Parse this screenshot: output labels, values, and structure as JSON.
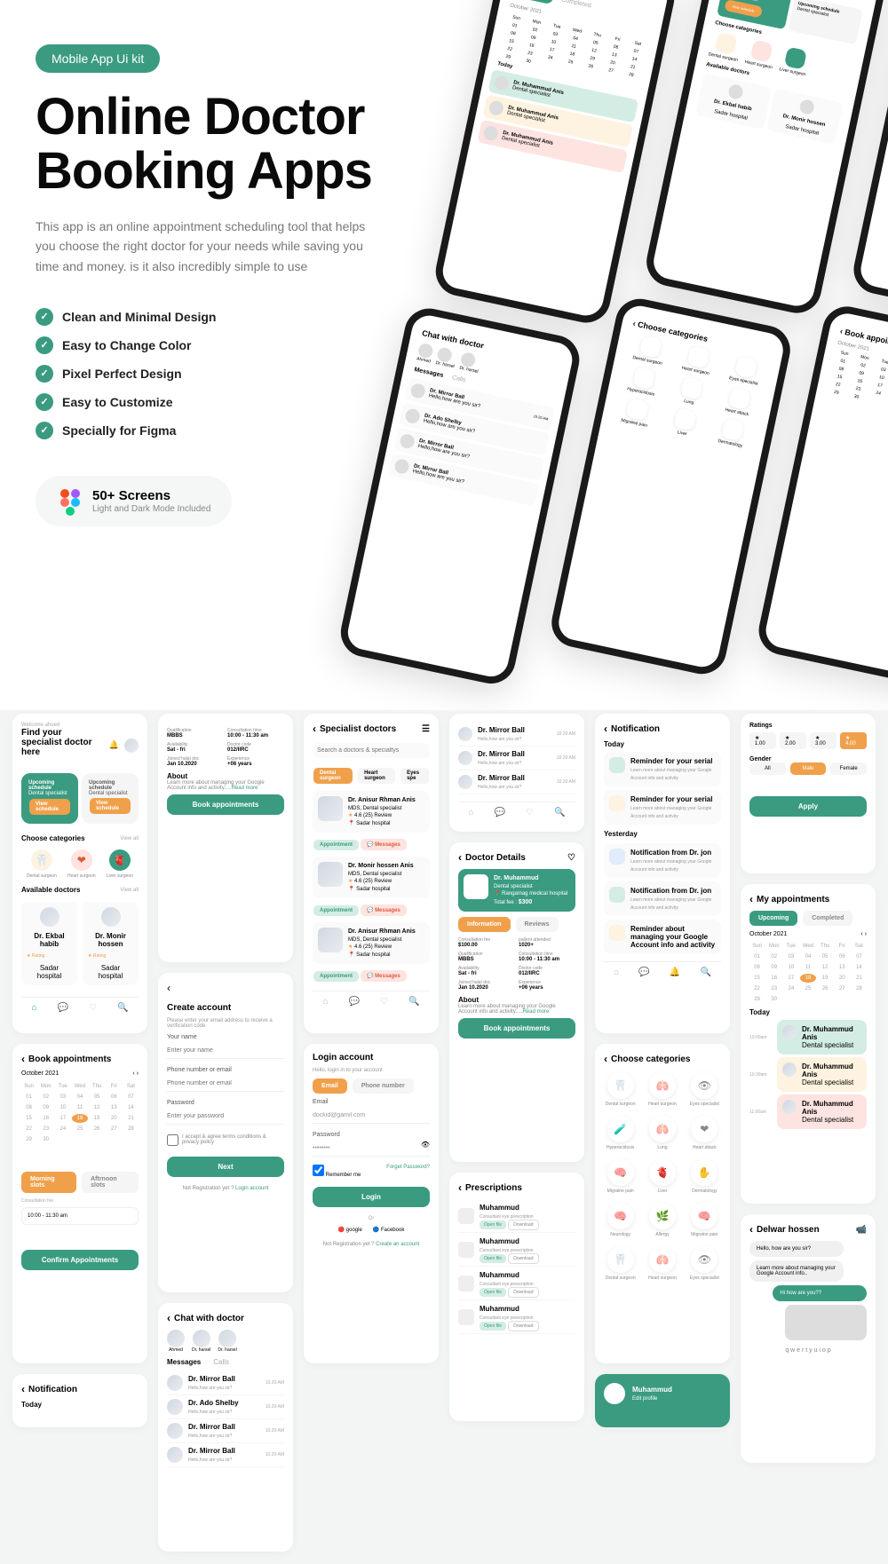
{
  "hero": {
    "badge": "Mobile App Ui kit",
    "title": "Online Doctor Booking Apps",
    "description": "This app is an online appointment scheduling tool that helps you choose the right doctor for your needs while saving you time and money. is it also incredibly simple to use",
    "features": [
      "Clean and Minimal Design",
      "Easy to Change Color",
      "Pixel Perfect Design",
      "Easy to Customize",
      "Specially for Figma"
    ],
    "screens_count": "50+ Screens",
    "screens_sub": "Light and Dark Mode Included"
  },
  "mockups": {
    "appointments": {
      "title": "My appointments",
      "tabs": [
        "Upcoming",
        "Completed"
      ],
      "month": "October 2021",
      "today_label": "Today",
      "doc_name": "Dr. Muhammud Anis",
      "doc_role": "Dental specialist"
    },
    "home": {
      "welcome": "Welcome ahoed",
      "headline": "Find your specialist doctor here",
      "upcoming_title": "Upcoming schedule",
      "upcoming_role": "Dental specialist",
      "view_btn": "View schedule",
      "cat_title": "Choose categories",
      "cats": [
        "Dental surgeon",
        "Heart surgeon",
        "Liver surgeon"
      ],
      "avail_title": "Available doctors",
      "doctors": [
        {
          "name": "Dr. Ekbal habib",
          "rating": "Rating",
          "hospital": "Sadar hospital"
        },
        {
          "name": "Dr. Monir hossen",
          "rating": "Rating",
          "hospital": "Sadar hospital"
        }
      ]
    },
    "chat": {
      "title": "Chat with doctor",
      "contacts": [
        "Ahmed",
        "Dr. harsel",
        "Dr. harsel"
      ],
      "tabs": [
        "Messages",
        "Calls"
      ],
      "msgs": [
        {
          "name": "Dr. Mirror Ball",
          "text": "Hello,how are you sir?",
          "time": "10.20 AM"
        },
        {
          "name": "Dr. Ado Shelby",
          "text": "Hello,how are you sir?",
          "time": "10.20 AM"
        },
        {
          "name": "Dr. Mirror Ball",
          "text": "Hello,how are you sir?",
          "time": "10.20 AM"
        },
        {
          "name": "Dr. Mirror Ball",
          "text": "Hello,how are you sir?",
          "time": "10.20 AM"
        }
      ]
    },
    "categories": {
      "title": "Choose categories",
      "items": [
        "Dental surgeon",
        "Heart surgeon",
        "Eyes specialist",
        "Hyperacidosis",
        "Lung",
        "Heart attack",
        "Migraine pain",
        "Liver",
        "Dermatology",
        "Neurology",
        "Allergy",
        "Migraine pain",
        "Dental surgeon",
        "Heart surgeon",
        "Eyes specialist"
      ]
    },
    "notifications": {
      "title": "Notification",
      "today": "Today",
      "yesterday": "Yesterday",
      "items": [
        "Reminder for your serial",
        "Reminder for your serial",
        "Notification from Dr. jon",
        "Reminder for your serial"
      ]
    },
    "book": {
      "title": "Book appointments",
      "month": "October 2021"
    }
  },
  "screens": {
    "home": {
      "welcome": "Welcome ahoed",
      "headline": "Find your specialist doctor here",
      "upcoming_title": "Upcoming schedule",
      "upcoming_role": "Dental specialist",
      "view_btn": "View schedule",
      "cat_title": "Choose categories",
      "viewall": "View all",
      "cats": [
        "Dental surgeon",
        "Heart surgeon",
        "Liver surgeon"
      ],
      "avail": "Available doctors",
      "doctors": [
        {
          "name": "Dr. Ekbal habib",
          "rating": "Rating",
          "loc": "Sadar hospital"
        },
        {
          "name": "Dr. Monir hossen",
          "rating": "Rating",
          "loc": "Sadar hospital"
        }
      ]
    },
    "details_top": {
      "qualification_k": "Qualification",
      "qualification_v": "MBBS",
      "consult_k": "Consultation time",
      "consult_v": "10:00 - 11:30 am",
      "avail_k": "Availability",
      "avail_v": "Sat - fri",
      "doctor_k": "Doctor code",
      "doctor_v": "012/IIRC",
      "joined_k": "Joined halal doc",
      "joined_v": "Jan 10.2020",
      "exp_k": "Experience",
      "exp_v": "+06 years",
      "about_title": "About",
      "about_text": "Learn more about managing your Google Account info and activity.....",
      "read_more": "Read more",
      "book_btn": "Book appointments"
    },
    "create_account": {
      "title": "Create account",
      "subtitle": "Please enter your email address to receive a verification code",
      "name_label": "Your name",
      "name_ph": "Enter your name",
      "phone_label": "Phone number or email",
      "phone_ph": "Phone number or email",
      "pass_label": "Password",
      "pass_ph": "Enter your password",
      "terms": "I accept & agree terms conditions & privacy policy",
      "next_btn": "Next",
      "footer": "Not Registration yet ?",
      "footer_link": "Login account"
    },
    "specialist": {
      "title": "Specialist doctors",
      "search_ph": "Search a doctors & specialtys",
      "chips": [
        "Dental surgeon",
        "Heart surgeon",
        "Eyes spe"
      ],
      "doctors": [
        {
          "name": "Dr. Anisur Rhman Anis",
          "role": "MDS, Dental specialist",
          "rating": "4.6 (25) Review",
          "loc": "Sadar hospital"
        },
        {
          "name": "Dr. Monir hossen Anis",
          "role": "MDS, Dental specialist",
          "rating": "4.6 (25) Review",
          "loc": "Sadar hospital"
        },
        {
          "name": "Dr. Anisur Rhman Anis",
          "role": "MDS, Dental specialist",
          "rating": "4.6 (25) Review",
          "loc": "Sadar hospital"
        }
      ],
      "appt_btn": "Appointment",
      "msg_btn": "Messages"
    },
    "login": {
      "title": "Login account",
      "subtitle": "Hello, login in to your account",
      "tabs": [
        "Email",
        "Phone number"
      ],
      "email_label": "Email",
      "email_val": "dockid@gamil.com",
      "pass_label": "Password",
      "remember": "Remember me",
      "forgot": "Forget Password?",
      "login_btn": "Login",
      "or": "Or",
      "google": "google",
      "facebook": "Facebook",
      "footer": "Not Registration yet ?",
      "footer_link": "Create an account"
    },
    "doctor_details": {
      "title": "Doctor Details",
      "name": "Dr. Muhammud",
      "role": "Dental specialist",
      "hospital": "Rangamag medical hospital",
      "fee_label": "Total fee :",
      "fee": "$300",
      "tabs": [
        "Information",
        "Reviews"
      ],
      "fee_k": "Consultation fee",
      "fee_v": "$100.00",
      "patients_k": "patient attended",
      "patients_v": "1020+",
      "qual_k": "Qualification",
      "qual_v": "MBBS",
      "time_k": "Consultation time",
      "time_v": "10:00 - 11:30 am",
      "avail_k": "Availability",
      "avail_v": "Sat - fri",
      "code_k": "Doctor code",
      "code_v": "012/IIRC",
      "join_k": "Joined halal doc",
      "join_v": "Jan 10.2020",
      "exp_k": "Experience",
      "exp_v": "+06 years",
      "about_title": "About",
      "about_text": "Learn more about managing your Google Account info and activity.....",
      "read_more": "Read more",
      "book_btn": "Book appointments"
    },
    "notification": {
      "title": "Notification",
      "today": "Today",
      "yesterday": "Yesterday",
      "items": [
        {
          "title": "Reminder for your serial",
          "desc": "Learn more about managing your Google Account info and activity"
        },
        {
          "title": "Reminder for your serial",
          "desc": "Learn more about managing your Google Account info and activity"
        },
        {
          "title": "Notification from Dr. jon",
          "desc": "Learn more about managing your Google Account info and activity"
        },
        {
          "title": "Notification from Dr. jon",
          "desc": "Learn more about managing your Google Account info and activity"
        },
        {
          "title": "Reminder about managing your Google Account info and activity",
          "desc": ""
        }
      ]
    },
    "filter": {
      "ratings_label": "Ratings",
      "ratings": [
        "★ 1.00",
        "★ 2.00",
        "★ 3.00",
        "★ 4.00"
      ],
      "gender_label": "Gender",
      "genders": [
        "All",
        "Male",
        "Female"
      ],
      "apply_btn": "Apply"
    },
    "book_appt": {
      "title": "Book appointments",
      "month": "October 2021",
      "days": [
        "Sun",
        "Mon",
        "Tue",
        "Wed",
        "Thu",
        "Fri",
        "Sat"
      ],
      "slots_tabs": [
        "Morning slots",
        "Aftrnoon slots"
      ],
      "consult_label": "Consultation fee",
      "times": "10:00 - 11:30 am",
      "confirm_btn": "Confirm Appointments"
    },
    "my_appt": {
      "title": "My appointments",
      "tabs": [
        "Upcoming",
        "Completed"
      ],
      "month": "October 2021",
      "days": [
        "Sun",
        "Mon",
        "Tue",
        "Wed",
        "Thu",
        "Fri",
        "Sat"
      ],
      "today": "Today",
      "times": [
        "10:00am",
        "10:30am",
        "11:00am"
      ],
      "doc": "Dr. Muhammud Anis",
      "role": "Dental specialist"
    },
    "chat_list": {
      "title": "Chat with doctor",
      "contacts": [
        "Ahmed",
        "Dr. harsel",
        "Dr. harsel"
      ],
      "tabs": [
        "Messages",
        "Calls"
      ],
      "items": [
        {
          "name": "Dr. Mirror Ball",
          "text": "Hello,how are you sir?",
          "time": "10.20 AM"
        },
        {
          "name": "Dr. Ado Shelby",
          "text": "Hello,how are you sir?",
          "time": "10.20 AM"
        },
        {
          "name": "Dr. Mirror Ball",
          "text": "Hello,how are you sir?",
          "time": "10.20 AM"
        },
        {
          "name": "Dr. Mirror Ball",
          "text": "Hello,how are you sir?",
          "time": "10.20 AM"
        }
      ]
    },
    "prescriptions": {
      "title": "Prescriptions",
      "name": "Muhammud",
      "sub": "Consultant eye prescription",
      "open": "Open file",
      "download": "Download"
    },
    "categories": {
      "title": "Choose categories",
      "items": [
        "Dental surgeon",
        "Heart surgeon",
        "Eyes specialist",
        "Hyperacidosis",
        "Lung",
        "Heart attack",
        "Migraine pain",
        "Liver",
        "Dermatology",
        "Neurology",
        "Allergy",
        "Migraine pain",
        "Dental surgeon",
        "Heart surgeon",
        "Eyes specialist"
      ]
    },
    "chat_detail": {
      "title": "Delwar hossen",
      "msg1": "Hello, how are you sir?",
      "msg2": "Learn more about managing your Google Account info..",
      "msg3": "Hi how are you??",
      "keyboard": "q w e r t y u i o p"
    },
    "profile": {
      "name": "Muhammud",
      "action": "Edit profile"
    },
    "notification2": {
      "title": "Notification",
      "today": "Today"
    }
  }
}
